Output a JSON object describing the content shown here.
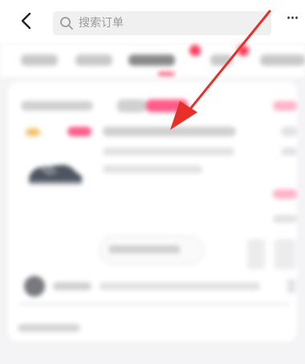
{
  "search": {
    "placeholder_text": "搜索订单"
  },
  "header": {
    "more_label": "···"
  },
  "colors": {
    "accent": "#ff3b5c",
    "arrow": "#e8302a"
  },
  "icons": {
    "back": "chevron-left-icon",
    "search": "search-icon",
    "more": "more-icon"
  }
}
